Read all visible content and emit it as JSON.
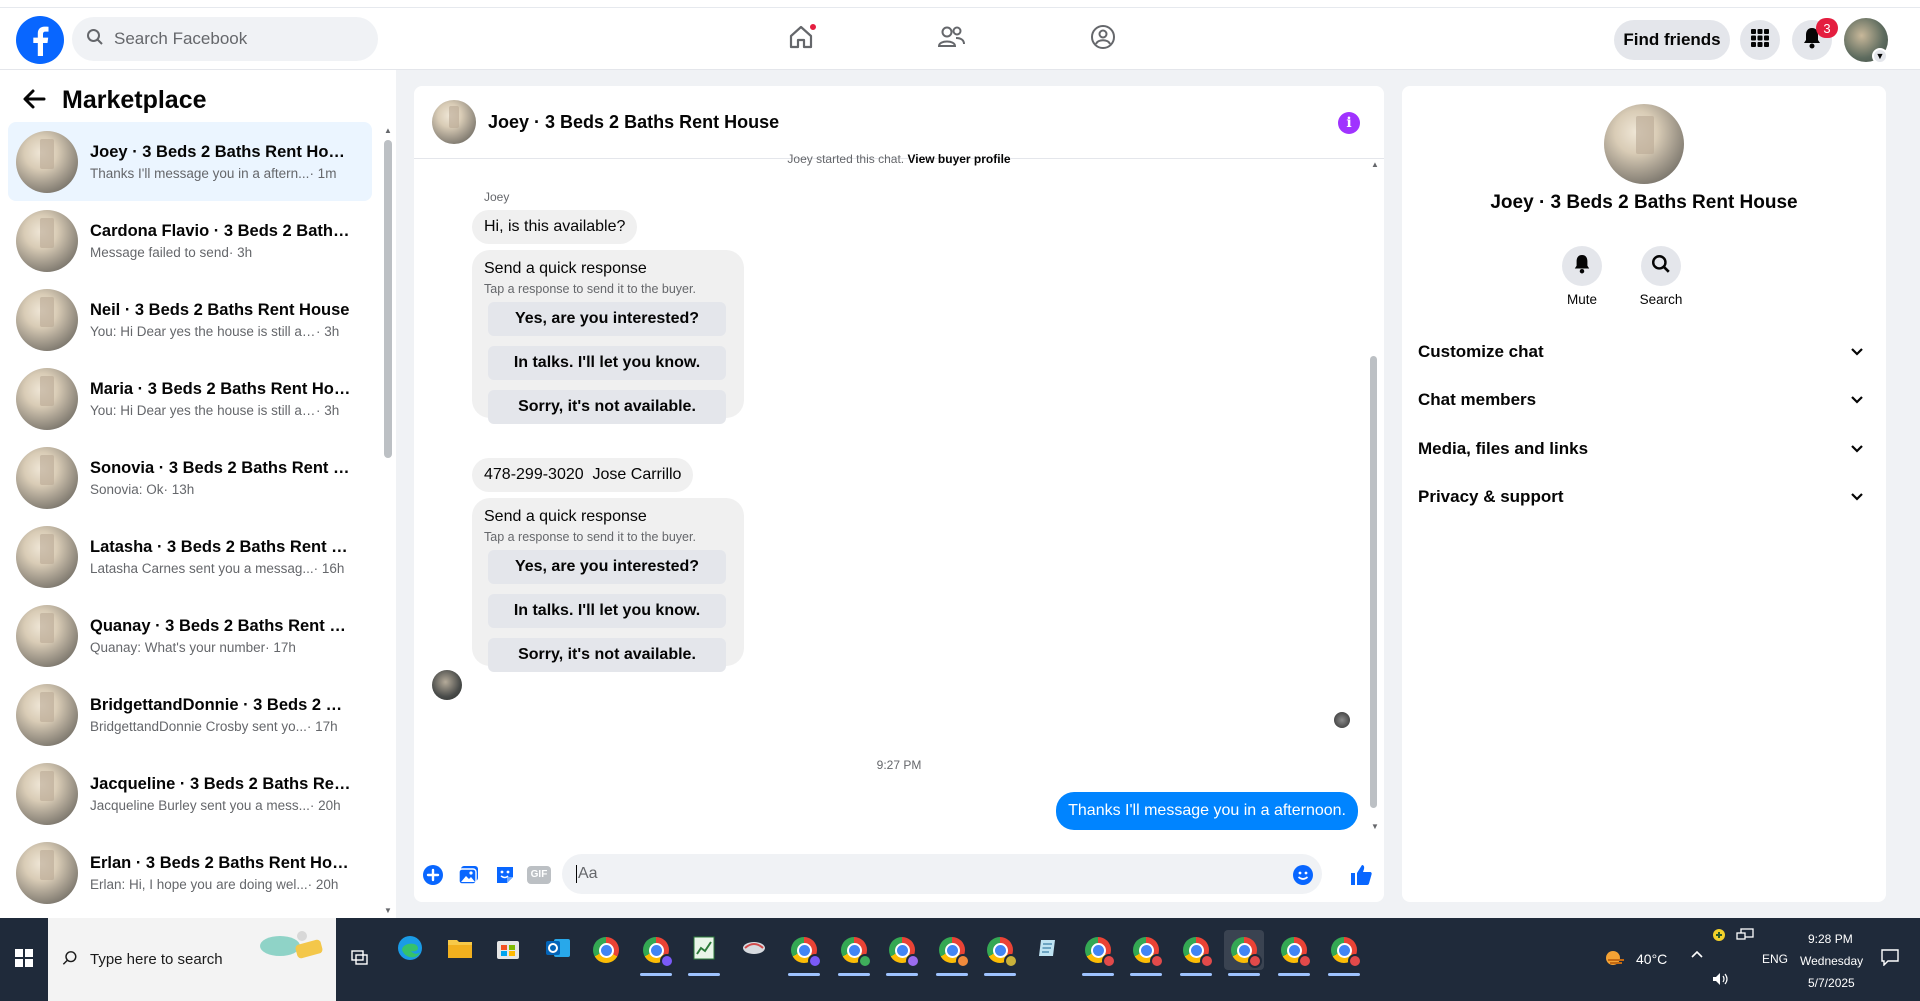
{
  "topbar": {
    "search_placeholder": "Search Facebook",
    "find_friends": "Find friends",
    "notification_count": "3"
  },
  "left": {
    "title": "Marketplace",
    "conversations": [
      {
        "title": "Joey · 3 Beds 2 Baths Rent House",
        "message": "Thanks I'll message you in a aftern...",
        "time": " · 1m",
        "active": true
      },
      {
        "title": "Cardona Flavio · 3 Beds 2 Baths ...",
        "message": "Message failed to send",
        "time": " · 3h"
      },
      {
        "title": "Neil · 3 Beds 2 Baths Rent House",
        "message": "You: Hi Dear yes the house is still av...",
        "time": " · 3h"
      },
      {
        "title": "Maria · 3 Beds 2 Baths Rent House",
        "message": "You: Hi Dear yes the house is still av...",
        "time": " · 3h"
      },
      {
        "title": "Sonovia · 3 Beds 2 Baths Rent H...",
        "message": "Sonovia: Ok",
        "time": " · 13h"
      },
      {
        "title": "Latasha · 3 Beds 2 Baths Rent Ho...",
        "message": "Latasha Carnes sent you a messag...",
        "time": " · 16h"
      },
      {
        "title": "Quanay · 3 Beds 2 Baths Rent H...",
        "message": "Quanay: What's your number",
        "time": " · 17h"
      },
      {
        "title": "BridgettandDonnie · 3 Beds 2 Ba...",
        "message": "BridgettandDonnie Crosby sent yo...",
        "time": " · 17h"
      },
      {
        "title": "Jacqueline · 3 Beds 2 Baths Rent ...",
        "message": "Jacqueline Burley sent you a mess...",
        "time": " · 20h"
      },
      {
        "title": "Erlan · 3 Beds 2 Baths Rent House",
        "message": "Erlan: Hi, I hope you are doing wel...",
        "time": " · 20h"
      }
    ]
  },
  "chat": {
    "title": "Joey · 3 Beds 2 Baths Rent House",
    "started_prefix": "Joey started this chat. ",
    "view_buyer": "View buyer profile",
    "sender_name": "Joey",
    "first_message": "Hi, is this available?",
    "quick_title": "Send a quick response",
    "quick_sub": "Tap a response to send it to the buyer.",
    "quick_options": [
      "Yes, are you interested?",
      "In talks. I'll let you know.",
      "Sorry, it's not available."
    ],
    "second_message": "478-299-3020  Jose Carrillo",
    "time_divider": "9:27 PM",
    "outgoing": "Thanks I'll message you in a afternoon.",
    "composer_placeholder": "Aa",
    "gif_label": "GIF"
  },
  "right": {
    "title": "Joey · 3 Beds 2 Baths Rent House",
    "mute": "Mute",
    "search": "Search",
    "sections": [
      "Customize chat",
      "Chat members",
      "Media, files and links",
      "Privacy & support"
    ]
  },
  "taskbar": {
    "search_placeholder": "Type here to search",
    "weather": "40°C",
    "lang": "ENG",
    "time": "9:28 PM",
    "day": "Wednesday",
    "date": "5/7/2025"
  },
  "colors": {
    "brand": "#0866ff",
    "outgoing_bubble": "#0084ff",
    "info": "#a033ff",
    "badge": "#e41e3f"
  }
}
